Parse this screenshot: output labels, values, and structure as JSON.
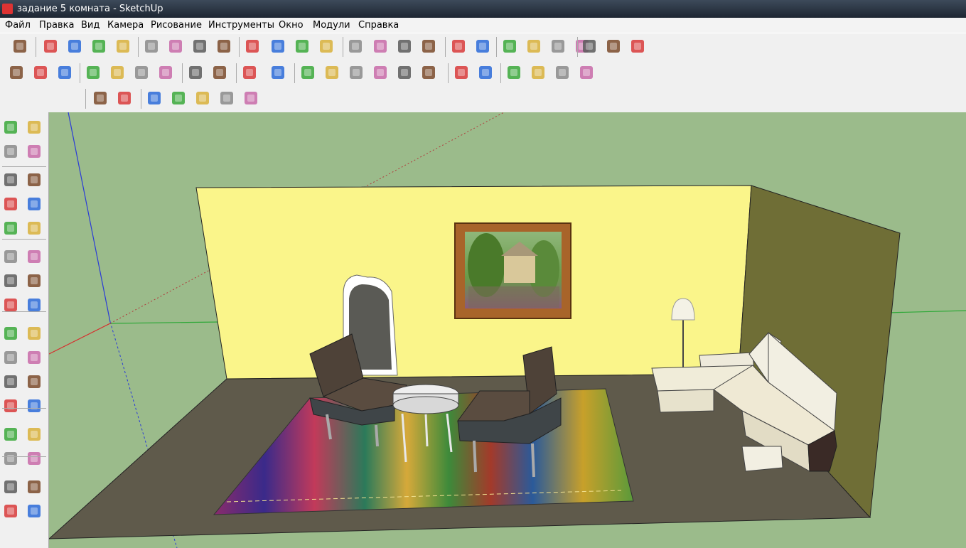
{
  "window": {
    "title": "задание 5 комната - SketchUp"
  },
  "menu": [
    "Файл",
    "Правка",
    "Вид",
    "Камера",
    "Рисование",
    "Инструменты",
    "Окно",
    "Модули",
    "Справка"
  ],
  "toolbar1": [
    "select-icon",
    "pencil-icon",
    "rectangle-icon",
    "circle-icon",
    "arc-icon",
    "eraser-icon",
    "eraser-pink-icon",
    "tape-measure-icon",
    "paint-bucket-icon",
    "push-pull-icon",
    "move-icon",
    "rotate-icon",
    "follow-me-icon",
    "orbit-icon",
    "pan-icon",
    "zoom-icon",
    "zoom-extents-icon",
    "get-models-icon",
    "share-model-icon",
    "component-icon",
    "person-icon",
    "upload-icon",
    "earth-icon",
    "layers-icon",
    "scenes-icon",
    "warehouse-icon"
  ],
  "toolbar2": [
    "new-file-icon",
    "open-file-icon",
    "save-icon",
    "cut-icon",
    "copy-icon",
    "paste-icon",
    "delete-icon",
    "undo-icon",
    "redo-icon",
    "print-icon",
    "info-icon",
    "iso-view-icon",
    "front-view-icon",
    "right-view-icon",
    "back-view-icon",
    "left-view-icon",
    "top-view-icon",
    "xray-style-icon",
    "wireframe-icon",
    "hidden-line-icon",
    "shaded-icon",
    "shaded-texture-icon",
    "monochrome-icon"
  ],
  "toolbar3": [
    "terrain-icon",
    "stamp-icon",
    "drape-icon",
    "smoove-icon",
    "add-detail-icon",
    "flip-edge-icon",
    "sandbox-icon"
  ],
  "lefttoolbar": [
    "select-icon",
    "component-icon",
    "paint-bucket-icon",
    "eraser-icon",
    "rectangle-icon",
    "pencil-icon",
    "circle-icon",
    "arc-icon",
    "polygon-icon",
    "freehand-icon",
    "move-icon",
    "push-pull-icon",
    "rotate-icon",
    "follow-me-icon",
    "scale-icon",
    "offset-icon",
    "tape-measure-icon",
    "dimension-icon",
    "protractor-icon",
    "text-icon",
    "axes-icon",
    "3d-text-icon",
    "orbit-icon",
    "pan-icon",
    "zoom-icon",
    "zoom-window-icon",
    "zoom-extents-icon",
    "previous-view-icon",
    "position-camera-icon",
    "look-around-icon",
    "walk-icon",
    "section-plane-icon"
  ],
  "colors": {
    "viewport": "#9bbb8b",
    "wall_back": "#faf58a",
    "wall_right": "#6f6e36",
    "floor": "#5f5a4b"
  }
}
